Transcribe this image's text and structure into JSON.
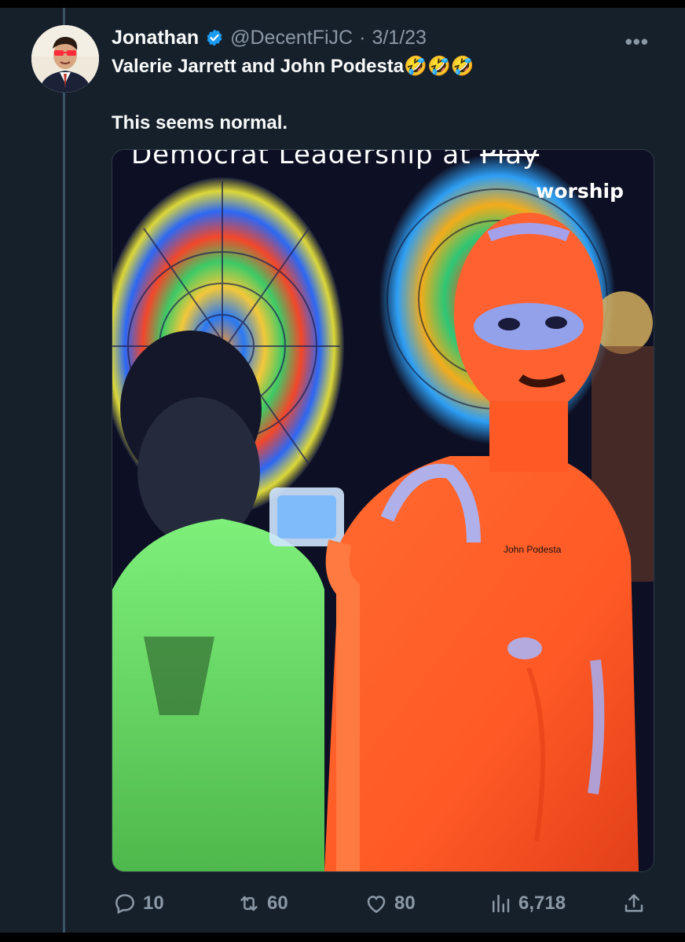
{
  "tweet": {
    "author_name": "Jonathan",
    "handle": "@DecentFiJC",
    "separator": "·",
    "date": "3/1/23",
    "more_label": "•••",
    "line1": "Valerie Jarrett and John Podesta🤣🤣🤣",
    "line2": "This seems normal."
  },
  "media": {
    "caption_prefix": "Democrat  Leadership  at ",
    "caption_struck": "Play",
    "caption_insert": "worship",
    "name_label": "John Podesta"
  },
  "actions": {
    "replies": "10",
    "retweets": "60",
    "likes": "80",
    "views": "6,718"
  },
  "colors": {
    "background": "#15202b",
    "text": "#f7f9f9",
    "muted": "#8b98a5",
    "verified": "#1d9bf0"
  }
}
